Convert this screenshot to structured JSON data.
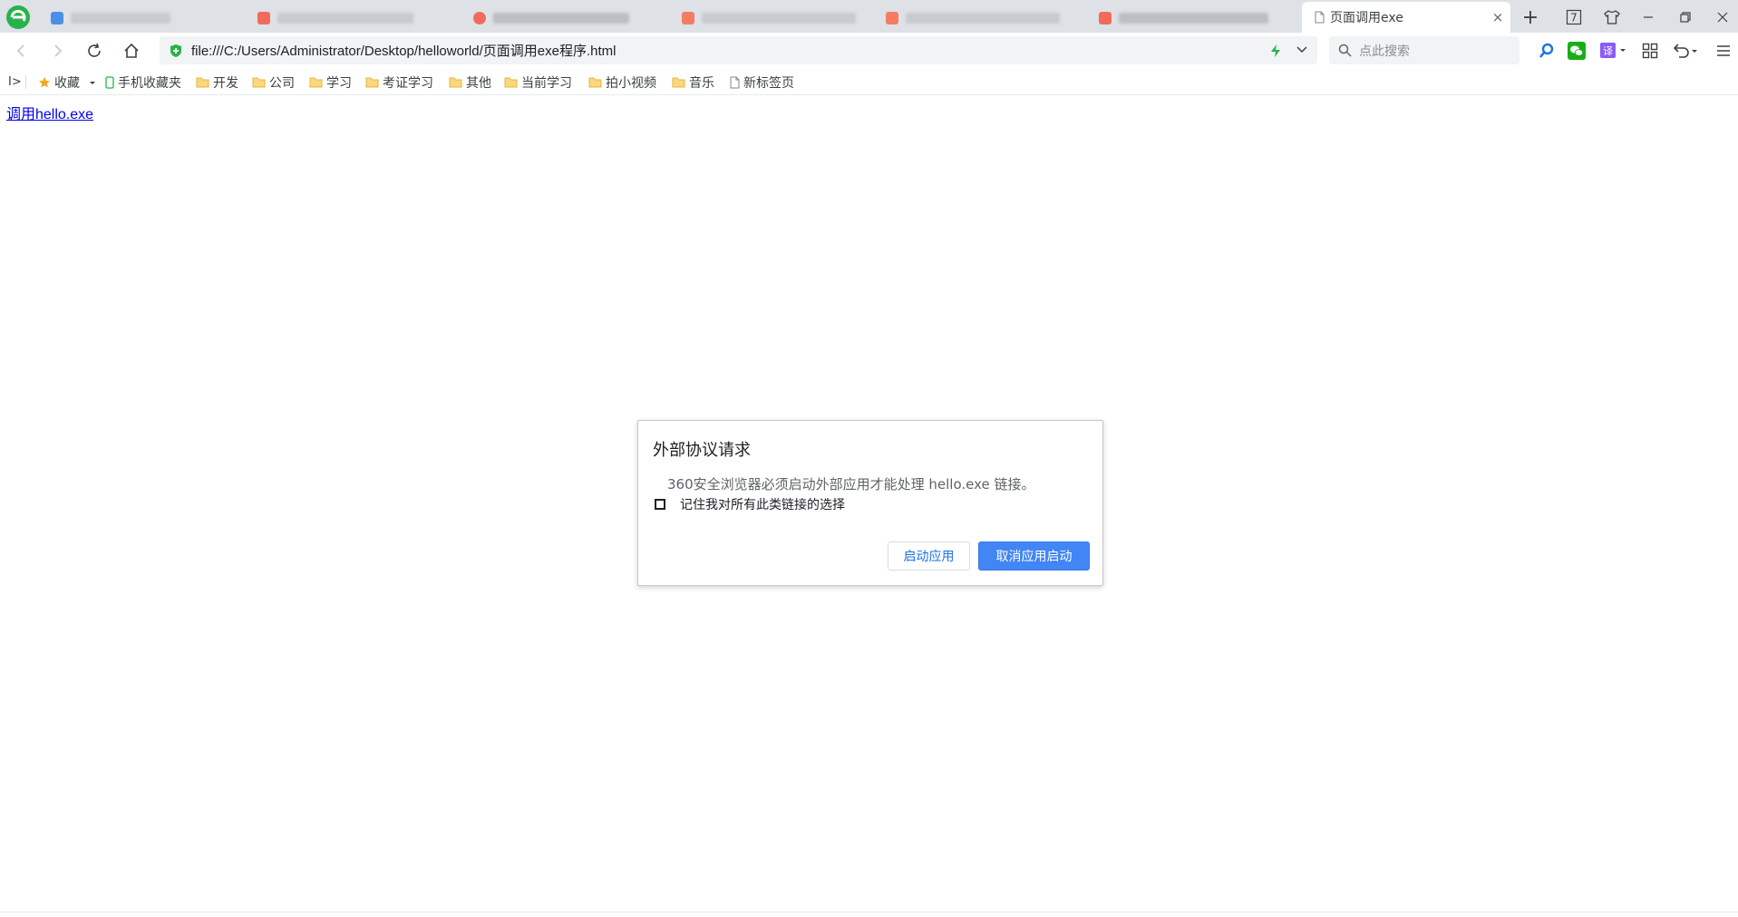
{
  "browser": {
    "active_tab_title": "页面调用exe",
    "new_tab_symbol": "+",
    "close_symbol": "×",
    "tab_count_badge": "7",
    "accent": "#4285f4"
  },
  "address": {
    "url": "file:///C:/Users/Administrator/Desktop/helloworld/页面调用exe程序.html"
  },
  "search": {
    "placeholder": "点此搜索"
  },
  "bookmarks": {
    "toggle": "I>",
    "items": [
      {
        "label": "收藏",
        "icon": "star-icon"
      },
      {
        "label": "手机收藏夹",
        "icon": "phone-icon"
      },
      {
        "label": "开发",
        "icon": "folder-icon"
      },
      {
        "label": "公司",
        "icon": "folder-icon"
      },
      {
        "label": "学习",
        "icon": "folder-icon"
      },
      {
        "label": "考证学习",
        "icon": "folder-icon"
      },
      {
        "label": "其他",
        "icon": "folder-icon"
      },
      {
        "label": "当前学习",
        "icon": "folder-icon"
      },
      {
        "label": "拍小视频",
        "icon": "folder-icon"
      },
      {
        "label": "音乐",
        "icon": "folder-icon"
      },
      {
        "label": "新标签页",
        "icon": "page-icon"
      }
    ]
  },
  "page": {
    "link_text": "调用hello.exe"
  },
  "dialog": {
    "title": "外部协议请求",
    "message": "360安全浏览器必须启动外部应用才能处理 hello.exe 链接。",
    "remember_label": "记住我对所有此类链接的选择",
    "launch_label": "启动应用",
    "cancel_label": "取消应用启动"
  }
}
